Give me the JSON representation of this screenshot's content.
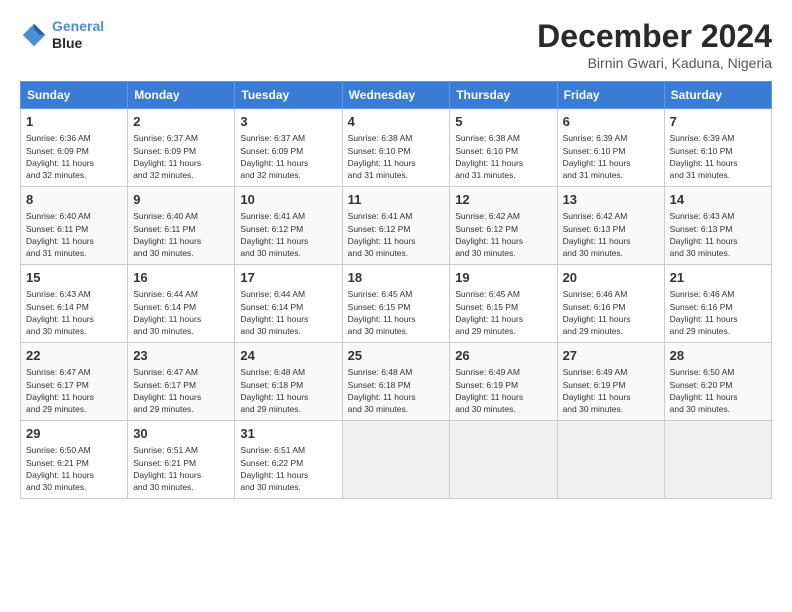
{
  "logo": {
    "line1": "General",
    "line2": "Blue"
  },
  "title": "December 2024",
  "subtitle": "Birnin Gwari, Kaduna, Nigeria",
  "weekdays": [
    "Sunday",
    "Monday",
    "Tuesday",
    "Wednesday",
    "Thursday",
    "Friday",
    "Saturday"
  ],
  "weeks": [
    [
      {
        "day": "1",
        "info": "Sunrise: 6:36 AM\nSunset: 6:09 PM\nDaylight: 11 hours\nand 32 minutes."
      },
      {
        "day": "2",
        "info": "Sunrise: 6:37 AM\nSunset: 6:09 PM\nDaylight: 11 hours\nand 32 minutes."
      },
      {
        "day": "3",
        "info": "Sunrise: 6:37 AM\nSunset: 6:09 PM\nDaylight: 11 hours\nand 32 minutes."
      },
      {
        "day": "4",
        "info": "Sunrise: 6:38 AM\nSunset: 6:10 PM\nDaylight: 11 hours\nand 31 minutes."
      },
      {
        "day": "5",
        "info": "Sunrise: 6:38 AM\nSunset: 6:10 PM\nDaylight: 11 hours\nand 31 minutes."
      },
      {
        "day": "6",
        "info": "Sunrise: 6:39 AM\nSunset: 6:10 PM\nDaylight: 11 hours\nand 31 minutes."
      },
      {
        "day": "7",
        "info": "Sunrise: 6:39 AM\nSunset: 6:10 PM\nDaylight: 11 hours\nand 31 minutes."
      }
    ],
    [
      {
        "day": "8",
        "info": "Sunrise: 6:40 AM\nSunset: 6:11 PM\nDaylight: 11 hours\nand 31 minutes."
      },
      {
        "day": "9",
        "info": "Sunrise: 6:40 AM\nSunset: 6:11 PM\nDaylight: 11 hours\nand 30 minutes."
      },
      {
        "day": "10",
        "info": "Sunrise: 6:41 AM\nSunset: 6:12 PM\nDaylight: 11 hours\nand 30 minutes."
      },
      {
        "day": "11",
        "info": "Sunrise: 6:41 AM\nSunset: 6:12 PM\nDaylight: 11 hours\nand 30 minutes."
      },
      {
        "day": "12",
        "info": "Sunrise: 6:42 AM\nSunset: 6:12 PM\nDaylight: 11 hours\nand 30 minutes."
      },
      {
        "day": "13",
        "info": "Sunrise: 6:42 AM\nSunset: 6:13 PM\nDaylight: 11 hours\nand 30 minutes."
      },
      {
        "day": "14",
        "info": "Sunrise: 6:43 AM\nSunset: 6:13 PM\nDaylight: 11 hours\nand 30 minutes."
      }
    ],
    [
      {
        "day": "15",
        "info": "Sunrise: 6:43 AM\nSunset: 6:14 PM\nDaylight: 11 hours\nand 30 minutes."
      },
      {
        "day": "16",
        "info": "Sunrise: 6:44 AM\nSunset: 6:14 PM\nDaylight: 11 hours\nand 30 minutes."
      },
      {
        "day": "17",
        "info": "Sunrise: 6:44 AM\nSunset: 6:14 PM\nDaylight: 11 hours\nand 30 minutes."
      },
      {
        "day": "18",
        "info": "Sunrise: 6:45 AM\nSunset: 6:15 PM\nDaylight: 11 hours\nand 30 minutes."
      },
      {
        "day": "19",
        "info": "Sunrise: 6:45 AM\nSunset: 6:15 PM\nDaylight: 11 hours\nand 29 minutes."
      },
      {
        "day": "20",
        "info": "Sunrise: 6:46 AM\nSunset: 6:16 PM\nDaylight: 11 hours\nand 29 minutes."
      },
      {
        "day": "21",
        "info": "Sunrise: 6:46 AM\nSunset: 6:16 PM\nDaylight: 11 hours\nand 29 minutes."
      }
    ],
    [
      {
        "day": "22",
        "info": "Sunrise: 6:47 AM\nSunset: 6:17 PM\nDaylight: 11 hours\nand 29 minutes."
      },
      {
        "day": "23",
        "info": "Sunrise: 6:47 AM\nSunset: 6:17 PM\nDaylight: 11 hours\nand 29 minutes."
      },
      {
        "day": "24",
        "info": "Sunrise: 6:48 AM\nSunset: 6:18 PM\nDaylight: 11 hours\nand 29 minutes."
      },
      {
        "day": "25",
        "info": "Sunrise: 6:48 AM\nSunset: 6:18 PM\nDaylight: 11 hours\nand 30 minutes."
      },
      {
        "day": "26",
        "info": "Sunrise: 6:49 AM\nSunset: 6:19 PM\nDaylight: 11 hours\nand 30 minutes."
      },
      {
        "day": "27",
        "info": "Sunrise: 6:49 AM\nSunset: 6:19 PM\nDaylight: 11 hours\nand 30 minutes."
      },
      {
        "day": "28",
        "info": "Sunrise: 6:50 AM\nSunset: 6:20 PM\nDaylight: 11 hours\nand 30 minutes."
      }
    ],
    [
      {
        "day": "29",
        "info": "Sunrise: 6:50 AM\nSunset: 6:21 PM\nDaylight: 11 hours\nand 30 minutes."
      },
      {
        "day": "30",
        "info": "Sunrise: 6:51 AM\nSunset: 6:21 PM\nDaylight: 11 hours\nand 30 minutes."
      },
      {
        "day": "31",
        "info": "Sunrise: 6:51 AM\nSunset: 6:22 PM\nDaylight: 11 hours\nand 30 minutes."
      },
      {
        "day": "",
        "info": ""
      },
      {
        "day": "",
        "info": ""
      },
      {
        "day": "",
        "info": ""
      },
      {
        "day": "",
        "info": ""
      }
    ]
  ]
}
